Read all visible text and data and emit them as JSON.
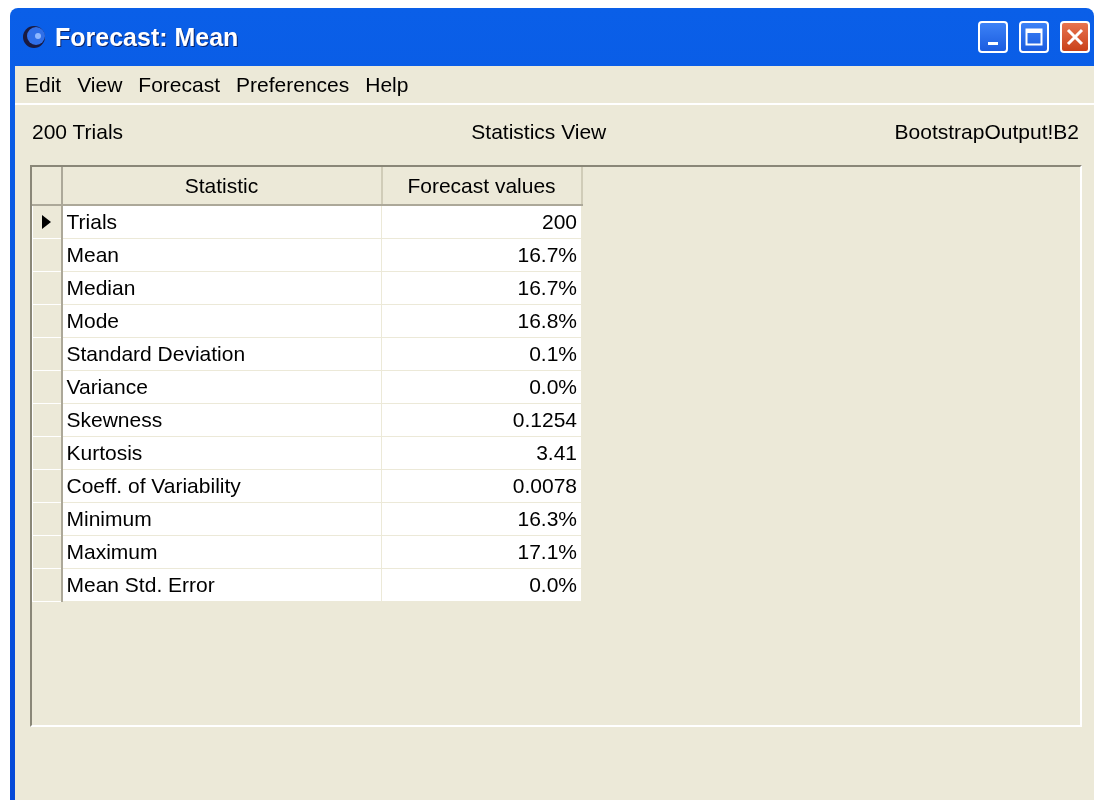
{
  "window": {
    "title": "Forecast: Mean"
  },
  "menu": [
    "Edit",
    "View",
    "Forecast",
    "Preferences",
    "Help"
  ],
  "info": {
    "trials": "200 Trials",
    "view": "Statistics View",
    "cell": "BootstrapOutput!B2"
  },
  "table": {
    "columns": [
      "Statistic",
      "Forecast values"
    ],
    "rows": [
      {
        "statistic": "Trials",
        "value": "200",
        "selected": true
      },
      {
        "statistic": "Mean",
        "value": "16.7%",
        "selected": false
      },
      {
        "statistic": "Median",
        "value": "16.7%",
        "selected": false
      },
      {
        "statistic": "Mode",
        "value": "16.8%",
        "selected": false
      },
      {
        "statistic": "Standard Deviation",
        "value": "0.1%",
        "selected": false
      },
      {
        "statistic": "Variance",
        "value": "0.0%",
        "selected": false
      },
      {
        "statistic": "Skewness",
        "value": "0.1254",
        "selected": false
      },
      {
        "statistic": "Kurtosis",
        "value": "3.41",
        "selected": false
      },
      {
        "statistic": "Coeff. of Variability",
        "value": "0.0078",
        "selected": false
      },
      {
        "statistic": "Minimum",
        "value": "16.3%",
        "selected": false
      },
      {
        "statistic": "Maximum",
        "value": "17.1%",
        "selected": false
      },
      {
        "statistic": "Mean Std. Error",
        "value": "0.0%",
        "selected": false
      }
    ]
  }
}
